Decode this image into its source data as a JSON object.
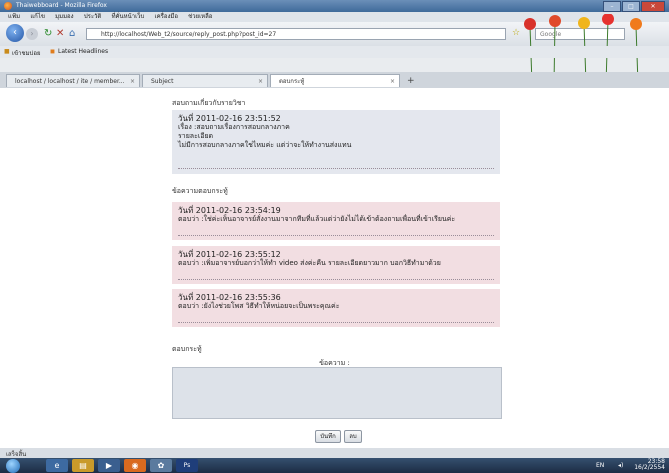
{
  "window": {
    "title": "Thaiwebboard - Mozilla Firefox",
    "controls": [
      "–",
      "□",
      "✕"
    ]
  },
  "menu": [
    "แฟ้ม",
    "แก้ไข",
    "มุมมอง",
    "ประวัติ",
    "ที่คั่นหน้าเว็บ",
    "เครื่องมือ",
    "ช่วยเหลือ"
  ],
  "nav": {
    "url": "http://localhost/Web_t2/source/reply_post.php?post_id=27",
    "search_placeholder": "Google"
  },
  "bookmarks": [
    "เข้าชมบ่อย",
    "Latest Headlines"
  ],
  "tabs": [
    {
      "label": "localhost / localhost / ite / member..."
    },
    {
      "label": "Subject"
    },
    {
      "label": "ตอบกระทู้"
    }
  ],
  "question": {
    "heading": "สอบถามเกี่ยวกับรายวิชา",
    "date": "วันที่ 2011-02-16 23:51:52",
    "subject": "เรื่อง :สอบถามเรื่องการสอบกลางภาค",
    "detail_label": "รายละเอียด",
    "detail": "ไม่มีการสอบกลางภาคใช่ไหมค่ะ แต่ว่าจะให้ทำงานส่งแทน"
  },
  "replies_heading": "ข้อความตอบกระทู้",
  "replies": [
    {
      "date": "วันที่ 2011-02-16 23:54:19",
      "text": "ตอบว่า :ใช่ค่ะเห็นอาจารย์สั่งงานมาจากทีมที่แล้วแต่ว่ายังไม่ได้เข้าต้องถามเพื่อนที่เข้าเรียนค่ะ"
    },
    {
      "date": "วันที่ 2011-02-16 23:55:12",
      "text": "ตอบว่า :เพิ่มอาจารย์บอกว่าให้ทำ video ส่งค่ะคืน รายละเอียดยาวมาก บอกวิธีทำมาด้วย"
    },
    {
      "date": "วันที่ 2011-02-16 23:55:36",
      "text": "ตอบว่า :ยังไงช่วยโพส วิธีทำให้หน่อยจะเป็นพระคุณค่ะ"
    }
  ],
  "answer": {
    "heading": "ตอบกระทู้",
    "label": "ข้อความ :",
    "submit": "บันทึก",
    "reset": "ลบ"
  },
  "status": "เสร็จสิ้น",
  "tray": {
    "lang": "EN",
    "time": "23:58",
    "date": "16/2/2554"
  }
}
